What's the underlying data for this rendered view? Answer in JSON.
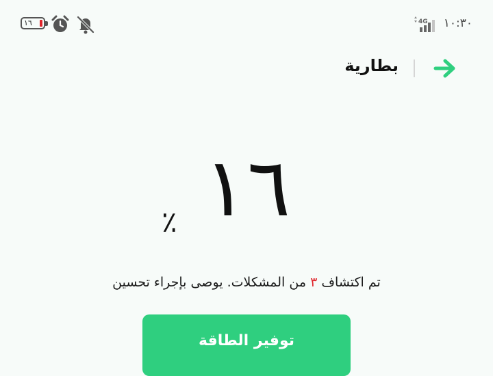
{
  "status_bar": {
    "time": "١٠:٣٠",
    "network": "4G",
    "battery_text": "١٦",
    "battery_fraction": 0.16,
    "icons": [
      "battery-icon",
      "alarm-icon",
      "mute-icon",
      "signal-icon"
    ],
    "battery_low_color": "#e0242b"
  },
  "header": {
    "title": "بطارية",
    "back_icon": "arrow-right-icon",
    "accent_color": "#2fcf7f"
  },
  "battery": {
    "level": "١٦",
    "level_value": 16,
    "percent_sign": "٪"
  },
  "issues": {
    "prefix": "تم اكتشاف",
    "count": "٣",
    "suffix": "من المشكلات. يوصى بإجراء تحسين"
  },
  "actions": {
    "save_power_label": "توفير الطاقة"
  }
}
